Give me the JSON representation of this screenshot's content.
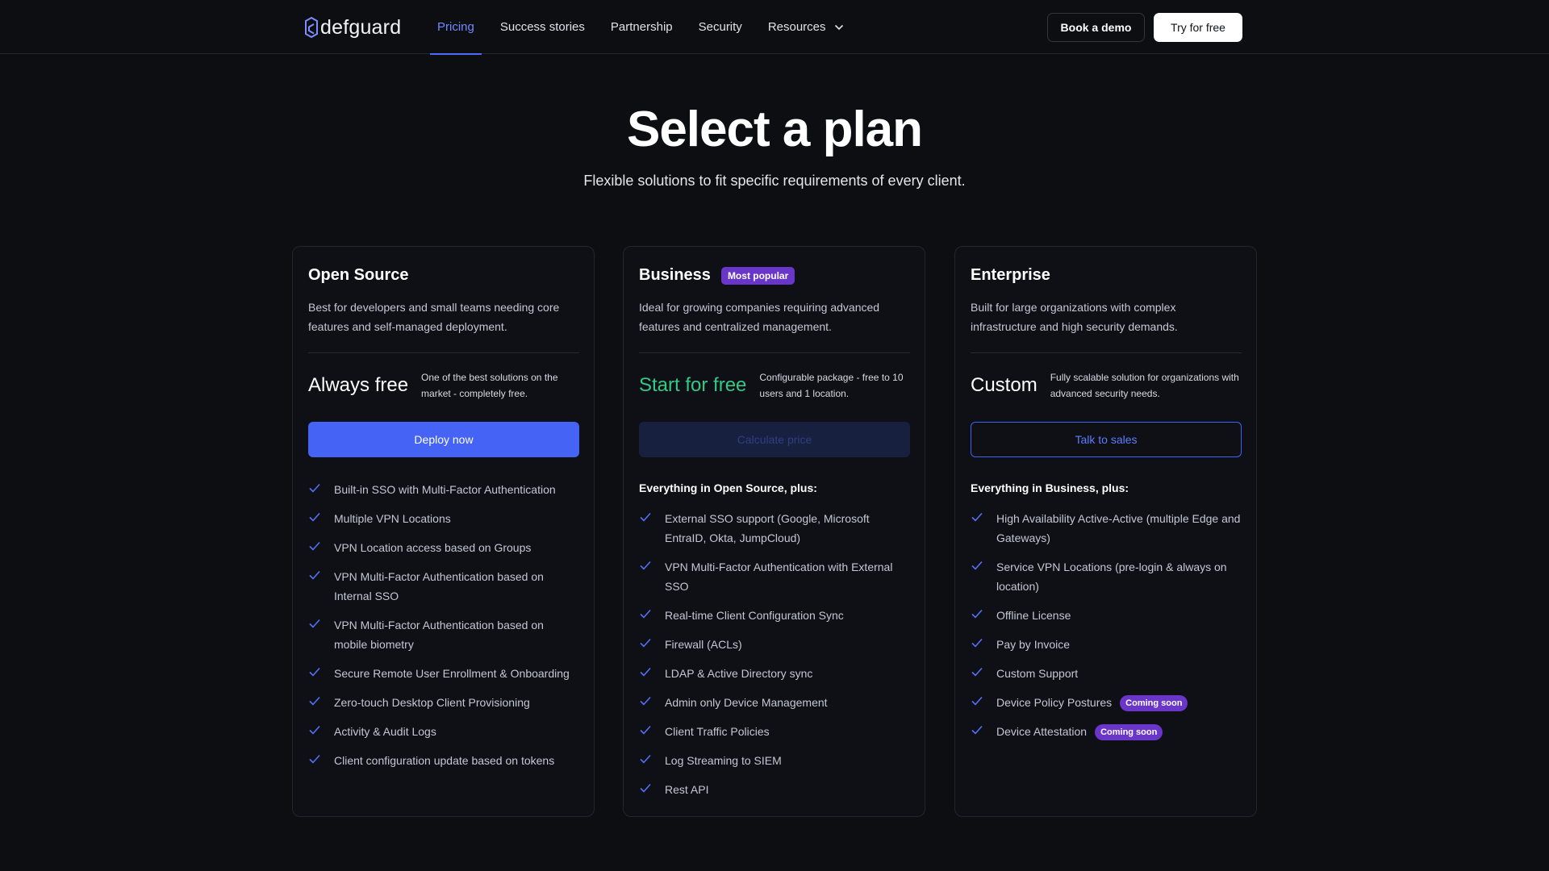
{
  "nav": {
    "logo_text": "defguard",
    "links": [
      "Pricing",
      "Success stories",
      "Partnership",
      "Security",
      "Resources"
    ],
    "active": "Pricing",
    "demo_label": "Book a demo",
    "try_label": "Try for free"
  },
  "hero": {
    "title": "Select a plan",
    "subtitle": "Flexible solutions to fit specific requirements of every client."
  },
  "colors": {
    "background": "#0c0e12",
    "accent": "#4563f5",
    "green": "#34c987",
    "badge": "#6a36c9"
  },
  "plans": [
    {
      "name": "Open Source",
      "desc": "Best for developers and small teams needing core features and self-managed deployment.",
      "price": "Always free",
      "price_note": "One of the best solutions on the market - completely free.",
      "cta": "Deploy now",
      "features_head": "",
      "features": [
        "Built-in SSO with Multi-Factor Authentication",
        "Multiple VPN Locations",
        "VPN Location access based on Groups",
        "VPN Multi-Factor Authentication based on Internal SSO",
        "VPN Multi-Factor Authentication based on mobile biometry",
        "Secure Remote User Enrollment & Onboarding",
        "Zero-touch Desktop Client Provisioning",
        "Activity & Audit Logs",
        "Client configuration update based on tokens"
      ]
    },
    {
      "name": "Business",
      "badge": "Most popular",
      "desc": "Ideal for growing companies requiring advanced features and centralized management.",
      "price": "Start for free",
      "price_note": "Configurable package - free to 10 users and 1 location.",
      "cta": "Calculate price",
      "features_head": "Everything in Open Source, plus:",
      "features": [
        "External SSO support (Google, Microsoft EntraID, Okta, JumpCloud)",
        "VPN Multi-Factor Authentication with External SSO",
        "Real-time Client Configuration Sync",
        "Firewall (ACLs)",
        "LDAP & Active Directory sync",
        "Admin only Device Management",
        "Client Traffic Policies",
        "Log Streaming to SIEM",
        "Rest API"
      ]
    },
    {
      "name": "Enterprise",
      "desc": "Built for large organizations with complex infrastructure and high security demands.",
      "price": "Custom",
      "price_note": "Fully scalable solution for organizations with advanced security needs.",
      "cta": "Talk to sales",
      "features_head": "Everything in Business, plus:",
      "features": [
        "High Availability Active-Active (multiple Edge and Gateways)",
        "Service VPN Locations (pre-login & always on location)",
        "Offline License",
        "Pay by Invoice",
        "Custom Support",
        "Device Policy Postures",
        "Device Attestation"
      ],
      "coming_soon_label": "Coming soon"
    }
  ]
}
